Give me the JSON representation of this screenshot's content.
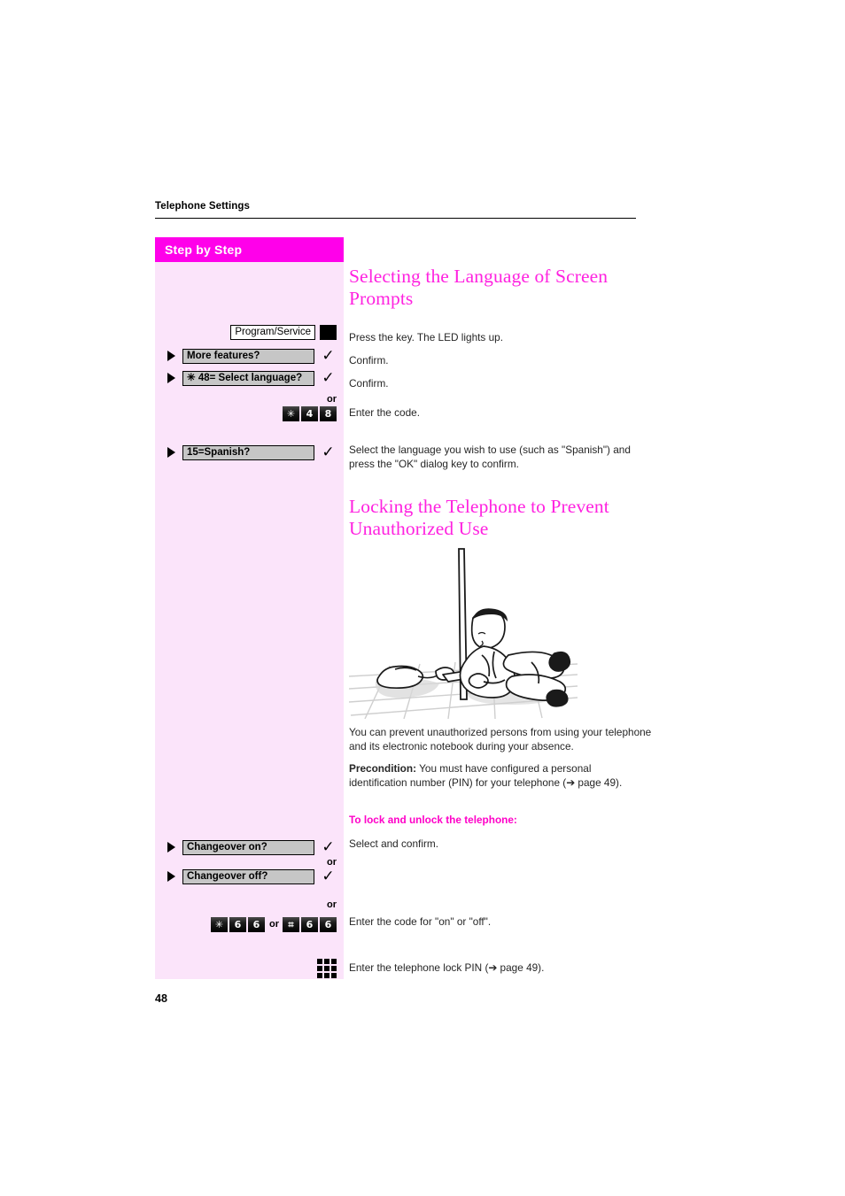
{
  "page": {
    "running_header": "Telephone Settings",
    "folio": "48"
  },
  "sidebar": {
    "header": "Step by Step",
    "or_label": "or",
    "rows": [
      {
        "key_label": "Program/Service",
        "icon": "led-key-icon"
      },
      {
        "display": "More features?",
        "icon": "check-icon"
      },
      {
        "display": "✳ 48= Select language?",
        "icon": "check-icon"
      },
      {
        "keys": [
          "✳",
          "4",
          "8"
        ]
      },
      {
        "display": "15=Spanish?",
        "icon": "check-icon"
      },
      {
        "display": "Changeover on?",
        "icon": "check-icon"
      },
      {
        "display": "Changeover off?",
        "icon": "check-icon"
      },
      {
        "keys_left": [
          "✳",
          "6",
          "6"
        ],
        "inline_or": "or",
        "keys_right": [
          "⌗",
          "6",
          "6"
        ]
      },
      {
        "icon": "keypad-icon"
      }
    ]
  },
  "content": {
    "heading_1": "Selecting the Language of Screen Prompts",
    "step_1": "Press the key. The LED lights up.",
    "step_2": "Confirm.",
    "step_3": "Confirm.",
    "step_4": "Enter the code.",
    "step_5": "Select the language you wish to use (such as \"Spanish\") and press the \"OK\" dialog key to confirm.",
    "heading_2": "Locking the Telephone to Prevent Unauthorized Use",
    "para_1": "You can prevent unauthorized persons from using your telephone and its electronic notebook during your absence.",
    "precondition_label": "Precondition:",
    "precondition_text": " You must have configured a personal identification number (PIN) for your telephone (➔ page 49).",
    "subheading_1": "To lock and unlock the telephone:",
    "step_6": "Select and confirm.",
    "step_7": "Enter the code for \"on\" or \"off\".",
    "step_8": "Enter the telephone lock PIN (➔ page 49)."
  },
  "illustration": {
    "alt": "person lying on floor reaching under a partition wall for a telephone handset"
  },
  "colors": {
    "sidebar_header_bg": "#ff00ea",
    "sidebar_body_bg": "#fbe4fa",
    "heading_magenta": "#ff22e0",
    "subheading_magenta": "#ff00c8",
    "display_box_bg": "#c6c6c6"
  }
}
